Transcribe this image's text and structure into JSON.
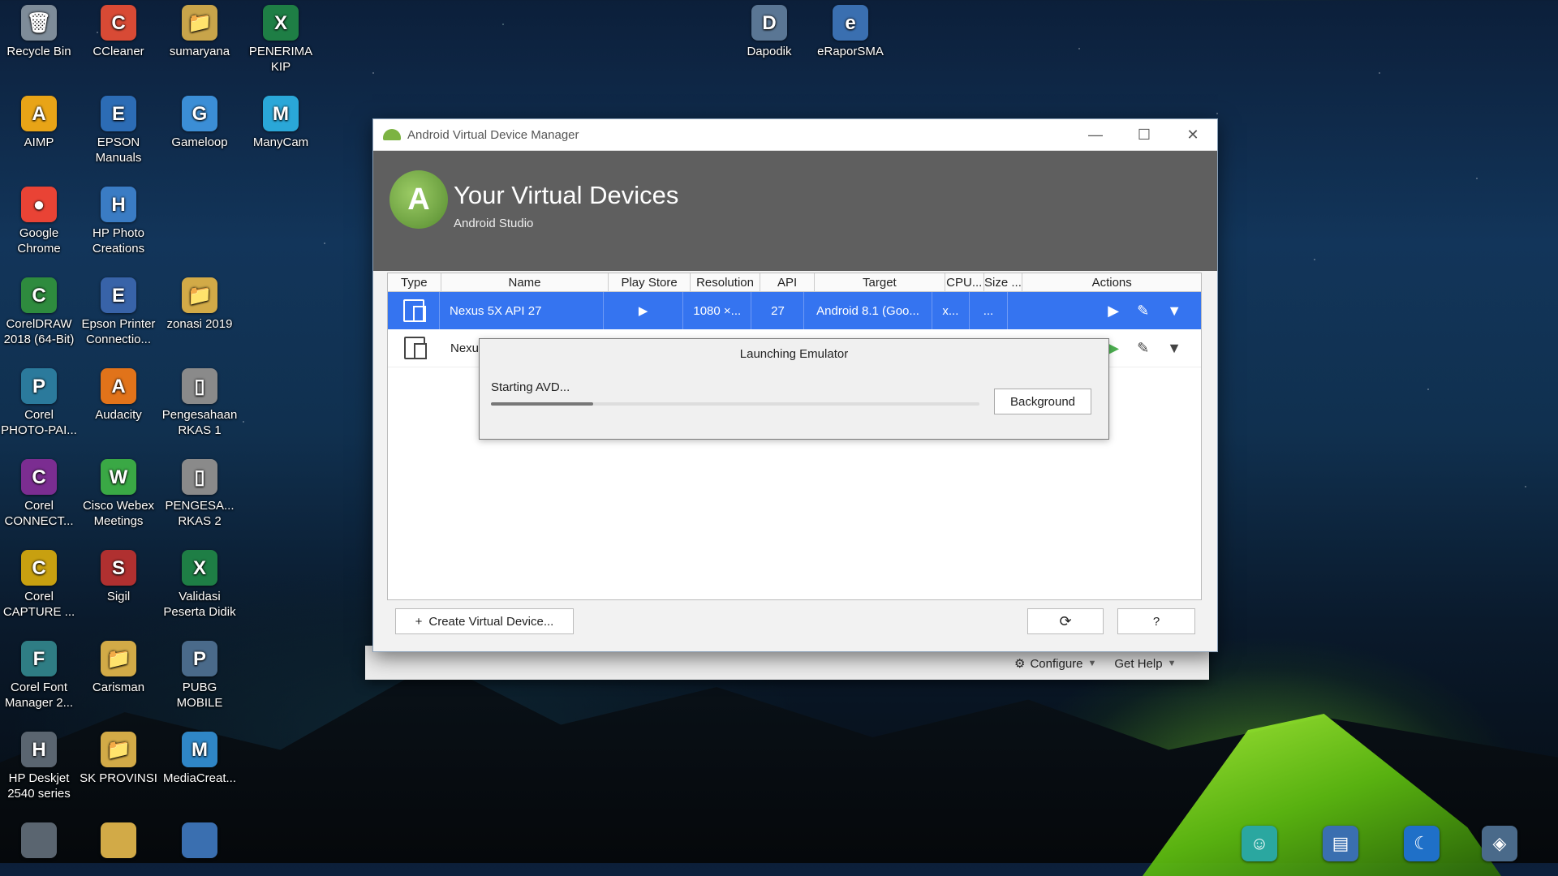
{
  "desktop": {
    "icons": [
      {
        "label": "Recycle Bin",
        "glyph": "🗑",
        "color": "#7e8c99"
      },
      {
        "label": "CCleaner",
        "glyph": "C",
        "color": "#d84a35"
      },
      {
        "label": "sumaryana",
        "glyph": "📁",
        "color": "#c8a44a"
      },
      {
        "label": "PENERIMA KIP",
        "glyph": "X",
        "color": "#1e7e45"
      },
      {
        "label": "AIMP",
        "glyph": "A",
        "color": "#e8a417"
      },
      {
        "label": "EPSON Manuals",
        "glyph": "E",
        "color": "#2c6cb5"
      },
      {
        "label": "Gameloop",
        "glyph": "G",
        "color": "#3b8ed6"
      },
      {
        "label": "ManyCam",
        "glyph": "M",
        "color": "#2aa7d8"
      },
      {
        "label": "Google Chrome",
        "glyph": "●",
        "color": "#e94335"
      },
      {
        "label": "HP Photo Creations",
        "glyph": "H",
        "color": "#3a7cc4"
      },
      {
        "label": "CorelDRAW 2018 (64-Bit)",
        "glyph": "C",
        "color": "#2e8b3e"
      },
      {
        "label": "Epson Printer Connectio...",
        "glyph": "E",
        "color": "#3863a8"
      },
      {
        "label": "zonasi 2019",
        "glyph": "📁",
        "color": "#d2aa47"
      },
      {
        "label": "Corel PHOTO-PAI...",
        "glyph": "P",
        "color": "#2b7a9c"
      },
      {
        "label": "Audacity",
        "glyph": "A",
        "color": "#e1731a"
      },
      {
        "label": "Pengesahaan RKAS 1",
        "glyph": "▯",
        "color": "#8a8a8a"
      },
      {
        "label": "Corel CONNECT...",
        "glyph": "C",
        "color": "#7b2d91"
      },
      {
        "label": "Cisco Webex Meetings",
        "glyph": "W",
        "color": "#3aa845"
      },
      {
        "label": "PENGESA... RKAS 2",
        "glyph": "▯",
        "color": "#8a8a8a"
      },
      {
        "label": "Corel CAPTURE ...",
        "glyph": "C",
        "color": "#c8a010"
      },
      {
        "label": "Sigil",
        "glyph": "S",
        "color": "#b03030"
      },
      {
        "label": "Validasi Peserta Didik",
        "glyph": "X",
        "color": "#1e7e45"
      },
      {
        "label": "Corel Font Manager 2...",
        "glyph": "F",
        "color": "#2f7d84"
      },
      {
        "label": "Carisman",
        "glyph": "📁",
        "color": "#d2aa47"
      },
      {
        "label": "PUBG MOBILE",
        "glyph": "P",
        "color": "#4a6a8a"
      },
      {
        "label": "HP Deskjet 2540 series",
        "glyph": "H",
        "color": "#5a6570"
      },
      {
        "label": "SK PROVINSI",
        "glyph": "📁",
        "color": "#d2aa47"
      },
      {
        "label": "MediaCreat...",
        "glyph": "M",
        "color": "#2f86c6"
      },
      {
        "label": "Dapodik",
        "glyph": "D",
        "color": "#5a7694"
      },
      {
        "label": "eRaporSMA",
        "glyph": "e",
        "color": "#3a6fb0"
      }
    ]
  },
  "window": {
    "title": "Android Virtual Device Manager",
    "header_title": "Your Virtual Devices",
    "header_subtitle": "Android Studio",
    "columns": [
      "Type",
      "Name",
      "Play Store",
      "Resolution",
      "API",
      "Target",
      "CPU...",
      "Size ...",
      "Actions"
    ],
    "rows": [
      {
        "name": "Nexus 5X API 27",
        "play_store": "▶",
        "resolution": "1080 ×...",
        "api": "27",
        "target": "Android 8.1 (Goo...",
        "cpu": "x...",
        "size": "..."
      },
      {
        "name": "Nexu",
        "play_store": "",
        "resolution": "",
        "api": "",
        "target": "",
        "cpu": "",
        "size": ""
      }
    ],
    "create_button": "Create Virtual Device...",
    "refresh_icon": "⟳",
    "help_label": "?",
    "configure_label": "Configure",
    "get_help_label": "Get Help"
  },
  "popup": {
    "title": "Launching Emulator",
    "status": "Starting AVD...",
    "progress_fraction": 0.21,
    "background_button": "Background"
  },
  "colors": {
    "accent": "#3574f0",
    "header_bg": "#5f5f5f",
    "run_green": "#4caf50"
  }
}
